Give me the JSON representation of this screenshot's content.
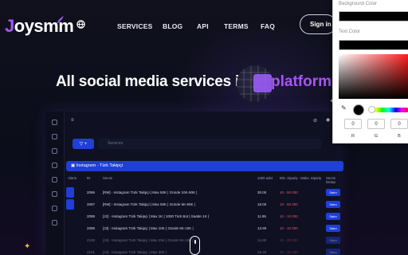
{
  "brand": {
    "logo_j": "J",
    "logo_rest": "oysmm"
  },
  "nav": {
    "links": [
      "SERVICES",
      "BLOG",
      "API",
      "TERMS",
      "FAQ"
    ],
    "signin": "Sign in"
  },
  "hero": {
    "text": "All social media services in",
    "highlight": "platform"
  },
  "dashboard": {
    "filter_label": "▽ +",
    "search_placeholder": "Services",
    "category": "▣ Instagram - Türk Takipçi",
    "columns": [
      "Alarm",
      "ID",
      "Servis",
      "1000 adet",
      "Min. Sipariş - Maks. Sipariş",
      "Servis Detayı"
    ],
    "rows": [
      {
        "id": "2096",
        "service": "[RM] - Instagram Türk Takipçi | Max 50K | Günde 10K-50K |",
        "price": "30.00",
        "minmax": "10 - 50 000",
        "buy": "Satın"
      },
      {
        "id": "2097",
        "service": "[RM] - Instagram Türk Takipçi | Max 50K | Günde 5K-50K |",
        "price": "18.00",
        "minmax": "10 - 50 000",
        "buy": "Satın"
      },
      {
        "id": "2098",
        "service": "[J2] - Instagram Türk Takipçi | Max 1K | 1000 Türk Bot | Saatte 1K |",
        "price": "11.95",
        "minmax": "10 - 10 000",
        "buy": "Satın"
      },
      {
        "id": "2099",
        "service": "[J3] - Instagram Türk Takipçi | Max 10K | Günde 5K-10K |",
        "price": "13.90",
        "minmax": "10 - 10 000",
        "buy": "Satın"
      },
      {
        "id": "2100",
        "service": "[J3] - Instagram Türk Takipçi | Max 25K | Günde 5K-10K |",
        "price": "14.80",
        "minmax": "10 - 25 000",
        "buy": "Satın"
      },
      {
        "id": "2101",
        "service": "[J4] - Instagram Türk Takipçi | Max 30K |",
        "price": "15.40",
        "minmax": "10 - 30 000",
        "buy": "Satın"
      }
    ]
  },
  "color_picker": {
    "bg_label": "Background Color",
    "text_label": "Text Color",
    "r": "0",
    "g": "0",
    "b": "0",
    "r_label": "R",
    "g_label": "G",
    "b_label": "B"
  },
  "colors": {
    "accent": "#a855f7",
    "primary_blue": "#1f3fd6",
    "background": "#0b0d1a"
  },
  "icons": [
    "feather-icon",
    "globe-icon",
    "sparkle-icon",
    "eyedropper-icon",
    "scroll-mouse-icon"
  ]
}
